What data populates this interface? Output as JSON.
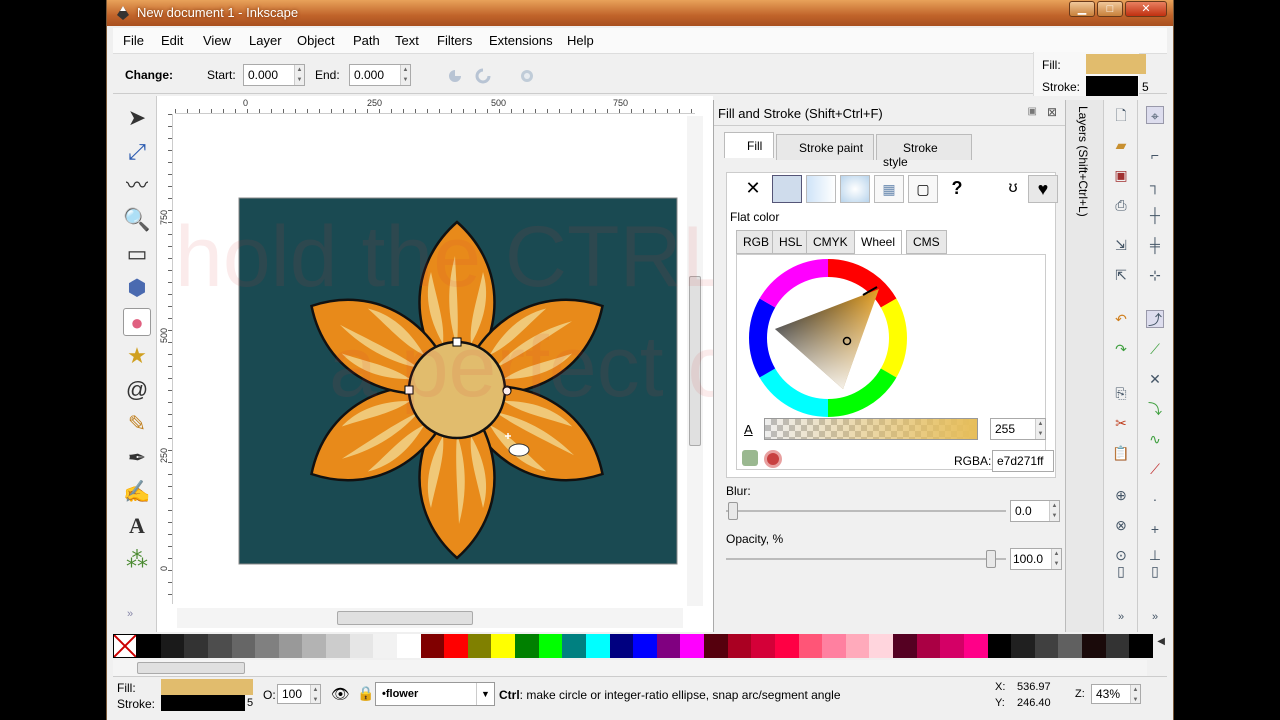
{
  "window": {
    "title": "New document 1 - Inkscape"
  },
  "menu": [
    "File",
    "Edit",
    "View",
    "Layer",
    "Object",
    "Path",
    "Text",
    "Filters",
    "Extensions",
    "Help"
  ],
  "controls": {
    "change_label": "Change:",
    "start_label": "Start:",
    "start_value": "0.000",
    "end_label": "End:",
    "end_value": "0.000"
  },
  "style_indicator": {
    "fill_label": "Fill:",
    "stroke_label": "Stroke:",
    "stroke_width": "5",
    "fill_color": "#e7d271",
    "stroke_color": "#000000"
  },
  "ruler": {
    "h_labels": [
      "0",
      "250",
      "500",
      "750"
    ],
    "v_labels": [
      "750",
      "500",
      "250",
      "0"
    ]
  },
  "watermark": {
    "line1": "hold the CTRL key for",
    "line2": "a perfect circle"
  },
  "dialog": {
    "title": "Fill and Stroke (Shift+Ctrl+F)",
    "tabs": [
      "Fill",
      "Stroke paint",
      "Stroke style"
    ],
    "flat_color_label": "Flat color",
    "color_tabs": [
      "RGB",
      "HSL",
      "CMYK",
      "Wheel",
      "CMS"
    ],
    "alpha_label": "A",
    "alpha_value": "255",
    "rgba_label": "RGBA:",
    "rgba_value": "e7d271ff",
    "blur_label": "Blur:",
    "blur_value": "0.0",
    "opacity_label": "Opacity, %",
    "opacity_value": "100.0",
    "side_tab": "Layers (Shift+Ctrl+L)"
  },
  "palette": [
    "#000000",
    "#1a1a1a",
    "#333333",
    "#4d4d4d",
    "#666666",
    "#808080",
    "#999999",
    "#b3b3b3",
    "#cccccc",
    "#e6e6e6",
    "#f2f2f2",
    "#ffffff",
    "#800000",
    "#ff0000",
    "#808000",
    "#ffff00",
    "#008000",
    "#00ff00",
    "#008080",
    "#00ffff",
    "#000080",
    "#0000ff",
    "#800080",
    "#ff00ff",
    "#55000d",
    "#aa0022",
    "#d40038",
    "#ff0044",
    "#ff5577",
    "#ff80a0",
    "#ffaabb",
    "#ffd5dd",
    "#550022",
    "#aa0044",
    "#d40066",
    "#ff0088",
    "#000000",
    "#202020",
    "#404040",
    "#606060",
    "#1a0a0a",
    "#333333",
    "#000000"
  ],
  "status": {
    "fill_label": "Fill:",
    "stroke_label": "Stroke:",
    "stroke_width": "5",
    "opacity_label": "O:",
    "opacity_value": "100",
    "layer": "•flower",
    "message_key": "Ctrl",
    "message": ": make circle or integer-ratio ellipse, snap arc/segment angle",
    "x_label": "X:",
    "x_value": "536.97",
    "y_label": "Y:",
    "y_value": "246.40",
    "zoom_label": "Z:",
    "zoom_value": "43%"
  },
  "colors": {
    "canvas_bg": "#1a4a52",
    "petal": "#e88a1a",
    "petal_vein": "#f0c878",
    "center": "#e7d271"
  }
}
